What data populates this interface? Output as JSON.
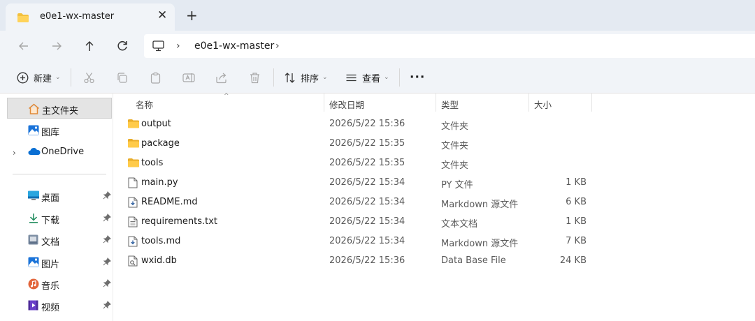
{
  "window": {
    "tab_title": "e0e1-wx-master",
    "tab_close": "✕",
    "new_tab": "+"
  },
  "address_bar": {
    "breadcrumbs": [
      "e0e1-wx-master"
    ],
    "separator": "›"
  },
  "command_bar": {
    "new_label": "新建",
    "sort_label": "排序",
    "view_label": "查看",
    "more_label": "···"
  },
  "sidebar": {
    "items": [
      {
        "label": "主文件夹",
        "icon": "home-icon"
      },
      {
        "label": "图库",
        "icon": "gallery-icon"
      },
      {
        "label": "OneDrive",
        "icon": "onedrive-icon"
      }
    ],
    "quick_access": [
      {
        "label": "桌面",
        "icon": "desktop-icon"
      },
      {
        "label": "下载",
        "icon": "download-icon"
      },
      {
        "label": "文档",
        "icon": "documents-icon"
      },
      {
        "label": "图片",
        "icon": "pictures-icon"
      },
      {
        "label": "音乐",
        "icon": "music-icon"
      },
      {
        "label": "视频",
        "icon": "videos-icon"
      }
    ]
  },
  "file_list": {
    "columns": [
      "名称",
      "修改日期",
      "类型",
      "大小"
    ],
    "rows": [
      {
        "name": "output",
        "date": "2026/5/22 15:36",
        "type": "文件夹",
        "size": "",
        "icon": "folder-icon"
      },
      {
        "name": "package",
        "date": "2026/5/22 15:35",
        "type": "文件夹",
        "size": "",
        "icon": "folder-icon"
      },
      {
        "name": "tools",
        "date": "2026/5/22 15:35",
        "type": "文件夹",
        "size": "",
        "icon": "folder-icon"
      },
      {
        "name": "main.py",
        "date": "2026/5/22 15:34",
        "type": "PY 文件",
        "size": "1 KB",
        "icon": "file-icon"
      },
      {
        "name": "README.md",
        "date": "2026/5/22 15:34",
        "type": "Markdown 源文件",
        "size": "6 KB",
        "icon": "markdown-file-icon"
      },
      {
        "name": "requirements.txt",
        "date": "2026/5/22 15:34",
        "type": "文本文档",
        "size": "1 KB",
        "icon": "text-file-icon"
      },
      {
        "name": "tools.md",
        "date": "2026/5/22 15:34",
        "type": "Markdown 源文件",
        "size": "7 KB",
        "icon": "markdown-file-icon"
      },
      {
        "name": "wxid.db",
        "date": "2026/5/22 15:36",
        "type": "Data Base File",
        "size": "24 KB",
        "icon": "database-file-icon"
      }
    ]
  },
  "colors": {
    "folder": "#f3c03d",
    "accent": "#0067c0",
    "chrome": "#f1f4f8"
  }
}
